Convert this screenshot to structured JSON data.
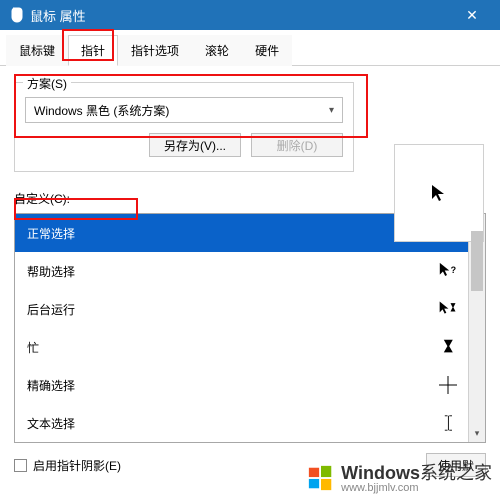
{
  "window": {
    "title": "鼠标 属性"
  },
  "tabs": [
    {
      "label": "鼠标键"
    },
    {
      "label": "指针",
      "active": true
    },
    {
      "label": "指针选项"
    },
    {
      "label": "滚轮"
    },
    {
      "label": "硬件"
    }
  ],
  "scheme": {
    "label": "方案(S)",
    "value": "Windows 黑色 (系统方案)",
    "save_as": "另存为(V)...",
    "delete": "删除(D)"
  },
  "custom_label": "自定义(C):",
  "items": [
    {
      "label": "正常选择",
      "icon": "arrow",
      "selected": true
    },
    {
      "label": "帮助选择",
      "icon": "arrow-help",
      "selected": false
    },
    {
      "label": "后台运行",
      "icon": "arrow-wait",
      "selected": false
    },
    {
      "label": "忙",
      "icon": "hourglass",
      "selected": false
    },
    {
      "label": "精确选择",
      "icon": "crosshair",
      "selected": false
    },
    {
      "label": "文本选择",
      "icon": "ibeam",
      "selected": false
    }
  ],
  "shadow_label": "启用指针阴影(E)",
  "use_default": "使用默",
  "watermark": {
    "brand": "Windows",
    "suffix": "系统之家",
    "url": "www.bjjmlv.com"
  },
  "colors": {
    "accent": "#0a62c9",
    "titlebar": "#2072b8",
    "highlight": "#e11"
  }
}
